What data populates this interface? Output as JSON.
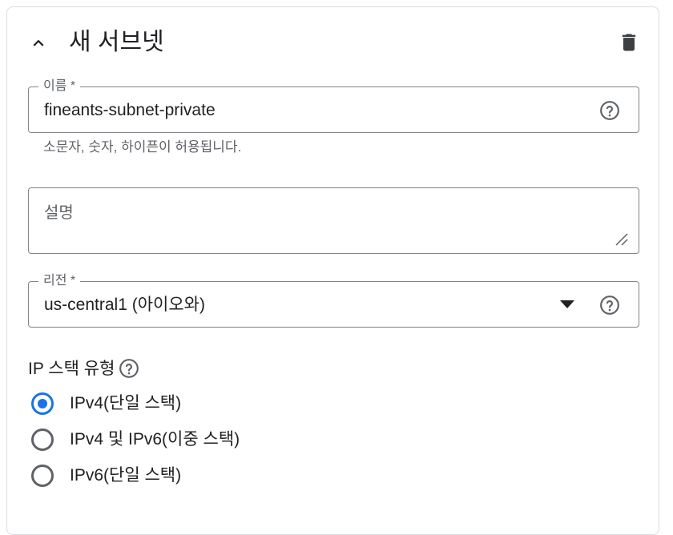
{
  "panel": {
    "title": "새 서브넷",
    "collapse_icon": "chevron-up-icon",
    "delete_icon": "trash-icon"
  },
  "name_field": {
    "label": "이름 *",
    "value": "fineants-subnet-private",
    "hint": "소문자, 숫자, 하이픈이 허용됩니다.",
    "help_icon": "help-circle-icon"
  },
  "description_field": {
    "placeholder": "설명",
    "resize_icon": "resize-handle-icon"
  },
  "region_field": {
    "label": "리전 *",
    "value": "us-central1 (아이오와)",
    "dropdown_icon": "dropdown-arrow-icon",
    "help_icon": "help-circle-icon"
  },
  "ip_stack": {
    "title": "IP 스택 유형",
    "help_icon": "help-circle-icon",
    "options": [
      {
        "label": "IPv4(단일 스택)",
        "selected": true
      },
      {
        "label": "IPv4 및 IPv6(이중 스택)",
        "selected": false
      },
      {
        "label": "IPv6(단일 스택)",
        "selected": false
      }
    ]
  },
  "colors": {
    "accent": "#1a73e8",
    "text": "#202124",
    "secondary_text": "#5f6368",
    "border": "#80868b"
  }
}
